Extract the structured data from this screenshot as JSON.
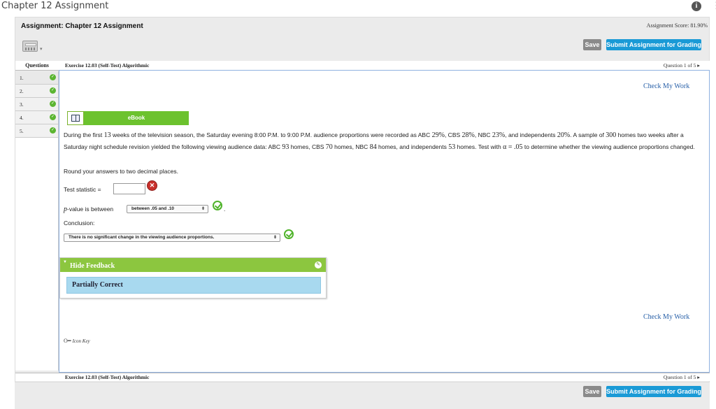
{
  "window": {
    "title": "Chapter 12 Assignment"
  },
  "assignment": {
    "heading": "Assignment: Chapter 12 Assignment",
    "score": "Assignment Score: 81.90%",
    "save_label": "Save",
    "submit_label": "Submit Assignment for Grading"
  },
  "questions": {
    "header": "Questions",
    "items": [
      {
        "num": "1."
      },
      {
        "num": "2."
      },
      {
        "num": "3."
      },
      {
        "num": "4."
      },
      {
        "num": "5."
      }
    ]
  },
  "exercise": {
    "title": "Exercise 12.03 (Self-Test) Algorithmic",
    "position": "Question 1 of 5 ▸",
    "check_my_work": "Check My Work",
    "ebook_label": "eBook",
    "problem": {
      "p1a": "During the first ",
      "weeks": "13",
      "p1b": " weeks of the television season, the Saturday evening 8:00 P.M. to 9:00 P.M. audience proportions were recorded as ABC ",
      "abc_pct": "29%",
      "p1c": ", CBS ",
      "cbs_pct": "28%",
      "p1d": ", NBC ",
      "nbc_pct": "23%",
      "p1e": ", and independents ",
      "ind_pct": "20%",
      "p1f": ". A sample of ",
      "homes": "300",
      "p1g": " homes two weeks after a Saturday night schedule revision yielded the following viewing audience data: ABC ",
      "abc_n": "93",
      "p1h": " homes, CBS ",
      "cbs_n": "70",
      "p1i": " homes, NBC ",
      "nbc_n": "84",
      "p1j": " homes, and independents ",
      "ind_n": "53",
      "p1k": " homes. Test with ",
      "alpha": "α = .05",
      "p1l": " to determine whether the viewing audience proportions changed."
    },
    "round_note": "Round your answers to two decimal places.",
    "test_stat_label": "Test statistic =",
    "test_stat_value": "",
    "pvalue_label_p": "p",
    "pvalue_label_rest": "-value is between",
    "pvalue_selected": "between .05 and .10",
    "conclusion_label": "Conclusion:",
    "conclusion_selected": "There is no significant change in the viewing audience proportions.",
    "feedback_toggle": "Hide Feedback",
    "feedback_result": "Partially Correct",
    "icon_key": "Icon Key"
  },
  "colors": {
    "accent_blue": "#1a9ad6",
    "ebook_green": "#6cc22e",
    "feedback_green": "#8cc63f",
    "feedback_result_bg": "#a8d9ef",
    "error_red": "#c9302c",
    "link_blue": "#2860a8"
  }
}
